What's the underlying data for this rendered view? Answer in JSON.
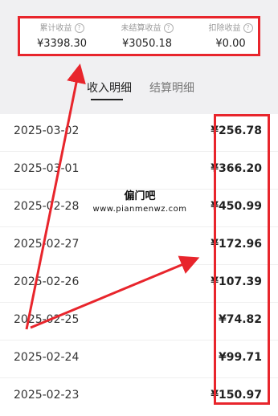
{
  "summary": {
    "stats": [
      {
        "label": "累计收益",
        "value": "¥3398.30"
      },
      {
        "label": "未结算收益",
        "value": "¥3050.18"
      },
      {
        "label": "扣除收益",
        "value": "¥0.00"
      }
    ]
  },
  "tabs": {
    "income_detail": "收入明细",
    "settlement_detail": "结算明细"
  },
  "rows": [
    {
      "date": "2025-03-02",
      "amount": "¥256.78"
    },
    {
      "date": "2025-03-01",
      "amount": "¥366.20"
    },
    {
      "date": "2025-02-28",
      "amount": "¥450.99"
    },
    {
      "date": "2025-02-27",
      "amount": "¥172.96"
    },
    {
      "date": "2025-02-26",
      "amount": "¥107.39"
    },
    {
      "date": "2025-02-25",
      "amount": "¥74.82"
    },
    {
      "date": "2025-02-24",
      "amount": "¥99.71"
    },
    {
      "date": "2025-02-23",
      "amount": "¥150.97"
    }
  ],
  "watermark": {
    "title": "偏门吧",
    "url": "www.pianmenwz.com"
  },
  "colors": {
    "highlight": "#e8252c",
    "header_bg": "#f0f0f2"
  },
  "icons": {
    "help": "question-circle-icon"
  }
}
